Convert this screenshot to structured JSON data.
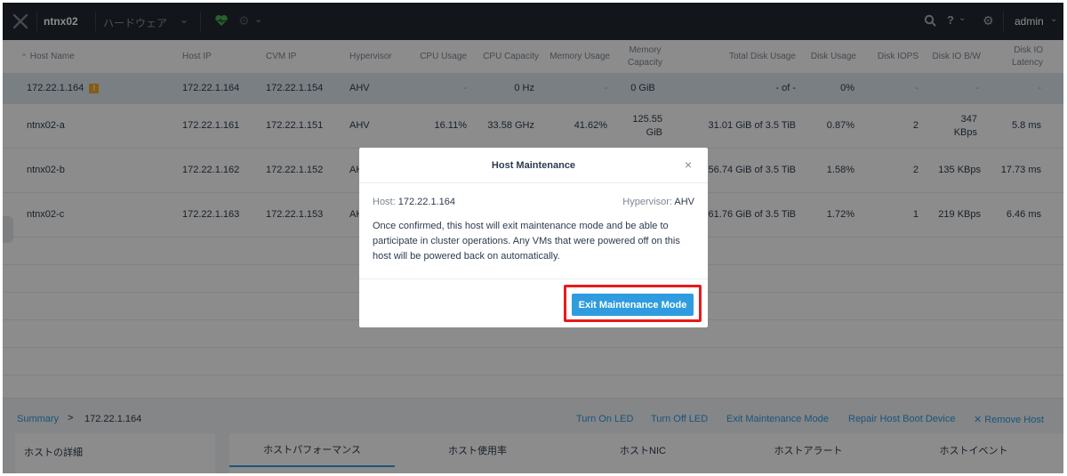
{
  "topbar": {
    "cluster_name": "ntnx02",
    "menu_label": "ハードウェア",
    "menu_caret": "⌄",
    "health_icon": "heart-icon",
    "settings_caret": "⌄",
    "search_icon": "search-icon",
    "help_label": "?",
    "help_caret": "⌄",
    "gear_icon": "gear-icon",
    "user": "admin",
    "user_caret": "⌄"
  },
  "table": {
    "columns": [
      {
        "label": "Host Name",
        "sort_indicator": "^"
      },
      {
        "label": "Host IP"
      },
      {
        "label": "CVM IP"
      },
      {
        "label": "Hypervisor"
      },
      {
        "label": "CPU Usage"
      },
      {
        "label": "CPU Capacity"
      },
      {
        "label": "Memory Usage"
      },
      {
        "label": "Memory Capacity"
      },
      {
        "label": "Total Disk Usage"
      },
      {
        "label": "Disk Usage"
      },
      {
        "label": "Disk IOPS"
      },
      {
        "label": "Disk IO B/W"
      },
      {
        "label": "Disk IO Latency"
      }
    ],
    "rows": [
      {
        "host_name": "172.22.1.164",
        "warning": "!",
        "host_ip": "172.22.1.164",
        "cvm_ip": "172.22.1.154",
        "hypervisor": "AHV",
        "cpu_usage": "-",
        "cpu_capacity": "0 Hz",
        "memory_usage": "-",
        "memory_capacity": "0 GiB",
        "total_disk_usage": "- of -",
        "disk_usage": "0%",
        "disk_iops": "-",
        "disk_io_bw": "-",
        "disk_io_latency": "-"
      },
      {
        "host_name": "ntnx02-a",
        "host_ip": "172.22.1.161",
        "cvm_ip": "172.22.1.151",
        "hypervisor": "AHV",
        "cpu_usage": "16.11%",
        "cpu_capacity": "33.58 GHz",
        "memory_usage": "41.62%",
        "memory_capacity": "125.55 GiB",
        "total_disk_usage": "31.01 GiB of 3.5 TiB",
        "disk_usage": "0.87%",
        "disk_iops": "2",
        "disk_io_bw": "347 KBps",
        "disk_io_latency": "5.8 ms"
      },
      {
        "host_name": "ntnx02-b",
        "host_ip": "172.22.1.162",
        "cvm_ip": "172.22.1.152",
        "hypervisor": "AH",
        "total_disk_usage": "56.74 GiB of 3.5 TiB",
        "disk_usage": "1.58%",
        "disk_iops": "2",
        "disk_io_bw": "135 KBps",
        "disk_io_latency": "17.73 ms"
      },
      {
        "host_name": "ntnx02-c",
        "host_ip": "172.22.1.163",
        "cvm_ip": "172.22.1.153",
        "hypervisor": "AH",
        "total_disk_usage": "61.76 GiB of 3.5 TiB",
        "disk_usage": "1.72%",
        "disk_iops": "1",
        "disk_io_bw": "219 KBps",
        "disk_io_latency": "6.46 ms"
      }
    ]
  },
  "summary": {
    "crumb": "Summary",
    "arrow": ">",
    "host": "172.22.1.164",
    "actions": [
      "Turn On LED",
      "Turn Off LED",
      "Exit Maintenance Mode",
      "Repair Host Boot Device",
      "✕ Remove Host"
    ]
  },
  "bottom": {
    "detail_title": "ホストの詳細",
    "tabs": [
      "ホストパフォーマンス",
      "ホスト使用率",
      "ホストNIC",
      "ホストアラート",
      "ホストイベント"
    ]
  },
  "modal": {
    "title": "Host Maintenance",
    "close": "×",
    "host_label": "Host:",
    "host_value": "172.22.1.164",
    "hypervisor_label": "Hypervisor:",
    "hypervisor_value": "AHV",
    "message": "Once confirmed, this host will exit maintenance mode and be able to participate in cluster operations. Any VMs that were powered off on this host will be powered back on automatically.",
    "button": "Exit Maintenance Mode"
  },
  "colors": {
    "topbar": "#22272e",
    "accent": "#2f9ce0",
    "health": "#4caf50",
    "warning": "#f5a623",
    "highlight": "#e8191a"
  }
}
